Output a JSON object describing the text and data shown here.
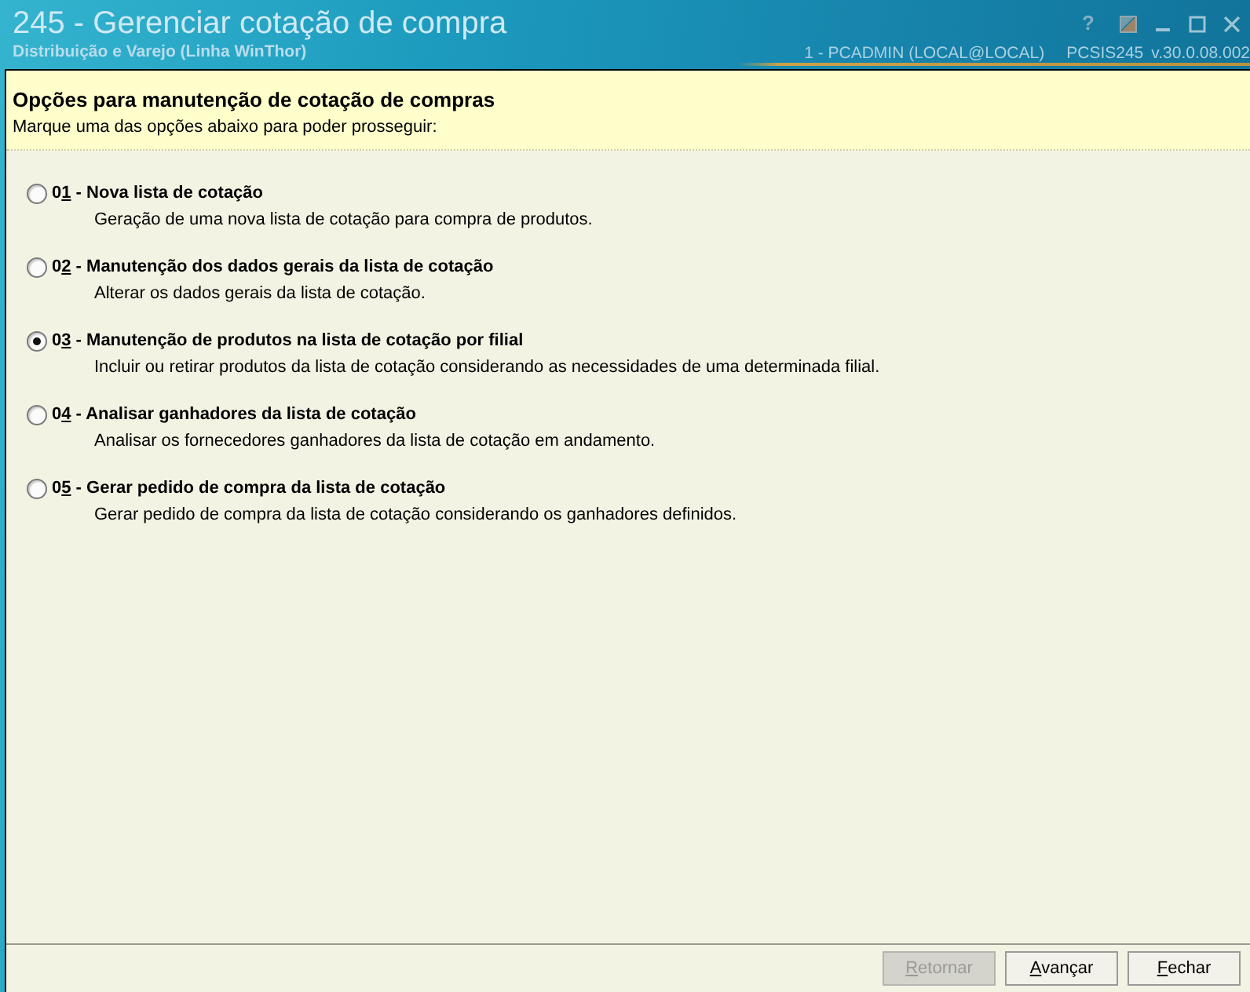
{
  "window": {
    "title": "245 - Gerenciar cotação de compra",
    "subtitle": "Distribuição e Varejo (Linha WinThor)",
    "help_glyph": "?"
  },
  "status": {
    "session": "1 - PCADMIN (LOCAL@LOCAL)",
    "program": "PCSIS245",
    "version": "v.30.0.08.002"
  },
  "header": {
    "title": "Opções para manutenção de cotação de compras",
    "instruction": "Marque uma das opções abaixo para poder prosseguir:"
  },
  "options": [
    {
      "number": "0",
      "access_key": "1",
      "title": " - Nova lista de cotação",
      "description": "Geração de uma nova lista de cotação para compra de produtos.",
      "selected": false
    },
    {
      "number": "0",
      "access_key": "2",
      "title": " - Manutenção dos dados gerais da lista de cotação",
      "description": "Alterar os dados gerais da lista de cotação.",
      "selected": false
    },
    {
      "number": "0",
      "access_key": "3",
      "title": " - Manutenção de produtos na lista de cotação por filial",
      "description": "Incluir ou retirar produtos da lista de cotação considerando as necessidades de uma determinada filial.",
      "selected": true
    },
    {
      "number": "0",
      "access_key": "4",
      "title": " - Analisar ganhadores da lista de cotação",
      "description": "Analisar os fornecedores ganhadores da lista de cotação em andamento.",
      "selected": false
    },
    {
      "number": "0",
      "access_key": "5",
      "title": " - Gerar pedido de compra da lista de cotação",
      "description": "Gerar pedido de compra da lista de cotação considerando os ganhadores definidos.",
      "selected": false
    }
  ],
  "buttons": [
    {
      "access_key": "R",
      "rest": "etornar",
      "disabled": true
    },
    {
      "access_key": "A",
      "rest": "vançar",
      "disabled": false
    },
    {
      "access_key": "F",
      "rest": "echar",
      "disabled": false
    }
  ]
}
